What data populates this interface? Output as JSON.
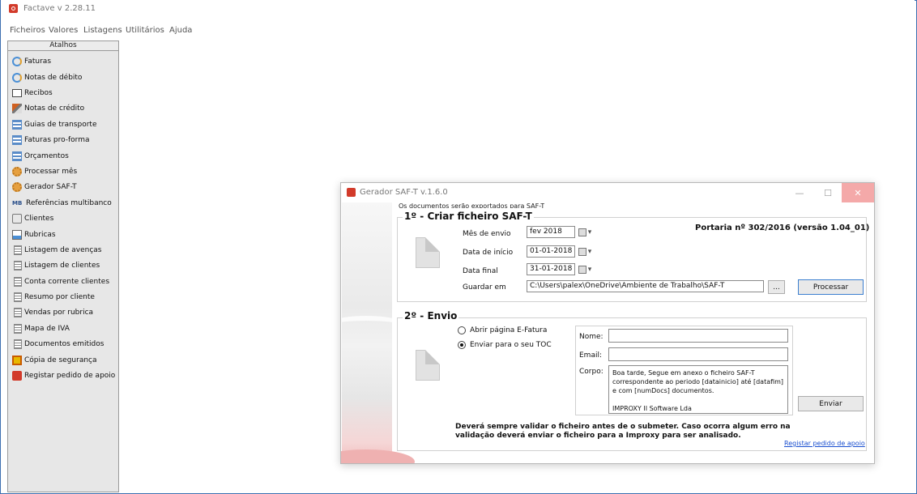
{
  "app": {
    "title": "Factave v 2.28.11"
  },
  "menu": [
    "Ficheiros",
    "Valores",
    "Listagens",
    "Utilitários",
    "Ajuda"
  ],
  "sidebar": {
    "header": "Atalhos",
    "items": [
      {
        "label": "Faturas",
        "icon": "pie-icon"
      },
      {
        "label": "Notas de débito",
        "icon": "pie-icon"
      },
      {
        "label": "Recibos",
        "icon": "receipt-icon"
      },
      {
        "label": "Notas de crédito",
        "icon": "pen-icon"
      },
      {
        "label": "Guias de transporte",
        "icon": "grid-icon"
      },
      {
        "label": "Faturas pro-forma",
        "icon": "grid-icon"
      },
      {
        "label": "Orçamentos",
        "icon": "grid-icon"
      },
      {
        "label": "Processar mês",
        "icon": "gear-icon"
      },
      {
        "label": "Gerador SAF-T",
        "icon": "gear-icon"
      },
      {
        "label": "Referências multibanco",
        "icon": "mb-icon",
        "icon_text": "MB"
      },
      {
        "label": "Clientes",
        "icon": "people-icon"
      },
      {
        "label": "Rubricas",
        "icon": "chart-icon"
      },
      {
        "label": "Listagem de avenças",
        "icon": "list-icon"
      },
      {
        "label": "Listagem de clientes",
        "icon": "list-icon"
      },
      {
        "label": "Conta corrente clientes",
        "icon": "list-icon"
      },
      {
        "label": "Resumo por cliente",
        "icon": "list-icon"
      },
      {
        "label": "Vendas por rubrica",
        "icon": "list-icon"
      },
      {
        "label": "Mapa de IVA",
        "icon": "list-icon"
      },
      {
        "label": "Documentos emitidos",
        "icon": "list-icon"
      },
      {
        "label": "Cópia de segurança",
        "icon": "backup-icon"
      },
      {
        "label": "Registar pedido de apoio",
        "icon": "support-icon"
      }
    ]
  },
  "dialog": {
    "title": "Gerador SAF-T  v.1.6.0",
    "exported_note": "Os documentos serão exportados para SAF-T",
    "section1": {
      "title": "1º - Criar ficheiro SAF-T",
      "portaria": "Portaria nº 302/2016 (versão 1.04_01)",
      "mes_label": "Mês de envio",
      "mes_value": "fev 2018",
      "inicio_label": "Data de início",
      "inicio_value": "01-01-2018",
      "final_label": "Data final",
      "final_value": "31-01-2018",
      "guardar_label": "Guardar em",
      "guardar_value": "C:\\Users\\palex\\OneDrive\\Ambiente de Trabalho\\SAF-T",
      "browse_label": "...",
      "processar_label": "Processar"
    },
    "section2": {
      "title": "2º - Envio",
      "radio1": "Abrir página E-Fatura",
      "radio2": "Enviar para o seu TOC",
      "selected": "radio2",
      "nome_label": "Nome:",
      "nome_value": "",
      "email_label": "Email:",
      "email_value": "",
      "corpo_label": "Corpo:",
      "corpo_value": "Boa tarde, Segue em anexo o ficheiro SAF-T correspondente ao periodo [datainicio] até [datafim] e com [numDocs] documentos.\n\nIMPROXY II Software Lda",
      "enviar_label": "Enviar"
    },
    "warning": "Deverá sempre validar o ficheiro antes de o submeter. Caso ocorra algum erro na validação deverá enviar o ficheiro para a Improxy para ser analisado.",
    "support_link": "Registar pedido de apoio"
  },
  "colors": {
    "accent_red": "#d23a2a",
    "link_blue": "#1a4fcf",
    "close_btn": "#f4a9a9"
  }
}
